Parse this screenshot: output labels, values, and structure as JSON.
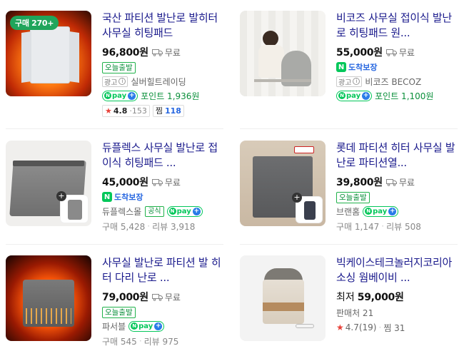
{
  "products": [
    {
      "title": "국산 파티션 발난로 발히터 사무실 히팅패드",
      "price": "96,800원",
      "shipping": "무료",
      "tag": "오늘출발",
      "ad_label": "광고",
      "seller": "실버힐트레이딩",
      "point": "포인트 1,936원",
      "rating": "4.8",
      "rating_sep": "·",
      "reviews": "153",
      "zzim_label": "찜",
      "zzim": "118",
      "buy_badge": "구매 270+"
    },
    {
      "title": "비코즈 사무실 접이식 발난로 히팅패드 원...",
      "price": "55,000원",
      "shipping": "무료",
      "arrive": "도착보장",
      "ad_label": "광고",
      "seller": "비코즈 BECOZ",
      "point": "포인트 1,100원"
    },
    {
      "title": "듀플렉스 사무실 발난로 접이식 히팅패드 ...",
      "price": "45,000원",
      "shipping": "무료",
      "arrive": "도착보장",
      "seller": "듀플렉스몰",
      "official": "공식",
      "buy_label": "구매 5,428",
      "review_label": "리뷰 3,918"
    },
    {
      "title": "롯데 파티션 히터 사무실 발난로 파티션열...",
      "price": "39,800원",
      "shipping": "무료",
      "tag": "오늘출발",
      "seller": "브랜홈",
      "buy_label": "구매 1,147",
      "review_label": "리뷰 508"
    },
    {
      "title": "사무실 발난로 파티션 발 히터 다리 난로 ...",
      "price": "79,000원",
      "shipping": "무료",
      "tag": "오늘출발",
      "seller": "파서블",
      "buy_label": "구매 545",
      "review_label": "리뷰 975"
    },
    {
      "title": "빅케이스테크놀러지코리아 소싱 웜베이비 ...",
      "price_prefix": "최저",
      "price": "59,000원",
      "sellers_label": "판매처 21",
      "rating_text": "4.7(19)",
      "zzim_text": "찜 31"
    }
  ],
  "npay_label": "pay",
  "npay_n": "N",
  "n_badge": "N",
  "colors": {
    "title": "#1a1a8c",
    "green": "#03c75a",
    "blue": "#2767e0",
    "star": "#e8423a"
  }
}
